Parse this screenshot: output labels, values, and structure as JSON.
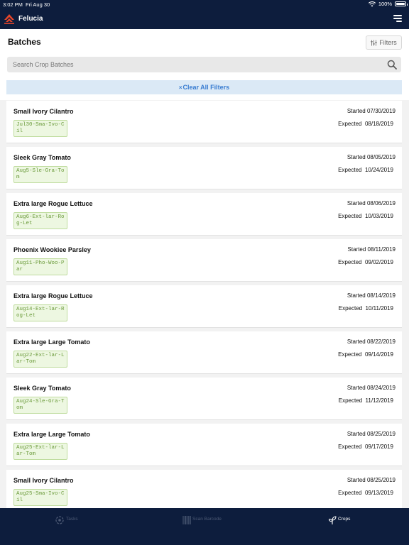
{
  "status_bar": {
    "time": "3:02 PM",
    "date": "Fri Aug 30",
    "battery": "100%"
  },
  "nav": {
    "app_title": "Felucia",
    "logo_icon": "felucia-logo-icon",
    "menu_icon": "hamburger-menu-icon"
  },
  "page": {
    "title": "Batches",
    "filters_label": "Filters",
    "search_placeholder": "Search Crop Batches",
    "clear_filters_label": "Clear All Filters",
    "clear_filters_prefix": "×"
  },
  "batches": [
    {
      "name": "Small Ivory Cilantro",
      "code": "Jul30-Sma-Ivo-Cil",
      "started_label": "Started",
      "started": "07/30/2019",
      "expected_label": "Expected",
      "expected": "08/18/2019"
    },
    {
      "name": "Sleek Gray Tomato",
      "code": "Aug5-Sle-Gra-Tom",
      "started_label": "Started",
      "started": "08/05/2019",
      "expected_label": "Expected",
      "expected": "10/24/2019"
    },
    {
      "name": "Extra large Rogue Lettuce",
      "code": "Aug6-Ext-lar-Rog-Let",
      "started_label": "Started",
      "started": "08/06/2019",
      "expected_label": "Expected",
      "expected": "10/03/2019"
    },
    {
      "name": "Phoenix Wookiee Parsley",
      "code": "Aug11-Pho-Woo-Par",
      "started_label": "Started",
      "started": "08/11/2019",
      "expected_label": "Expected",
      "expected": "09/02/2019"
    },
    {
      "name": "Extra large Rogue Lettuce",
      "code": "Aug14-Ext-lar-Rog-Let",
      "started_label": "Started",
      "started": "08/14/2019",
      "expected_label": "Expected",
      "expected": "10/11/2019"
    },
    {
      "name": "Extra large Large Tomato",
      "code": "Aug22-Ext-lar-Lar-Tom",
      "started_label": "Started",
      "started": "08/22/2019",
      "expected_label": "Expected",
      "expected": "09/14/2019"
    },
    {
      "name": "Sleek Gray Tomato",
      "code": "Aug24-Sle-Gra-Tom",
      "started_label": "Started",
      "started": "08/24/2019",
      "expected_label": "Expected",
      "expected": "11/12/2019"
    },
    {
      "name": "Extra large Large Tomato",
      "code": "Aug25-Ext-lar-Lar-Tom",
      "started_label": "Started",
      "started": "08/25/2019",
      "expected_label": "Expected",
      "expected": "09/17/2019"
    },
    {
      "name": "Small Ivory Cilantro",
      "code": "Aug25-Sma-Ivo-Cil",
      "started_label": "Started",
      "started": "08/25/2019",
      "expected_label": "Expected",
      "expected": "09/13/2019"
    }
  ],
  "tabs": [
    {
      "label": "Tasks",
      "icon": "tasks-icon",
      "active": false
    },
    {
      "label": "Scan Barcode",
      "icon": "barcode-icon",
      "active": false
    },
    {
      "label": "Crops",
      "icon": "sprout-icon",
      "active": true
    }
  ],
  "colors": {
    "nav_background": "#0d1d3d",
    "accent_blue": "#3a7dd1",
    "code_green": "#6a9a3a",
    "code_background": "#edf7e1",
    "logo_red": "#e8462a"
  }
}
